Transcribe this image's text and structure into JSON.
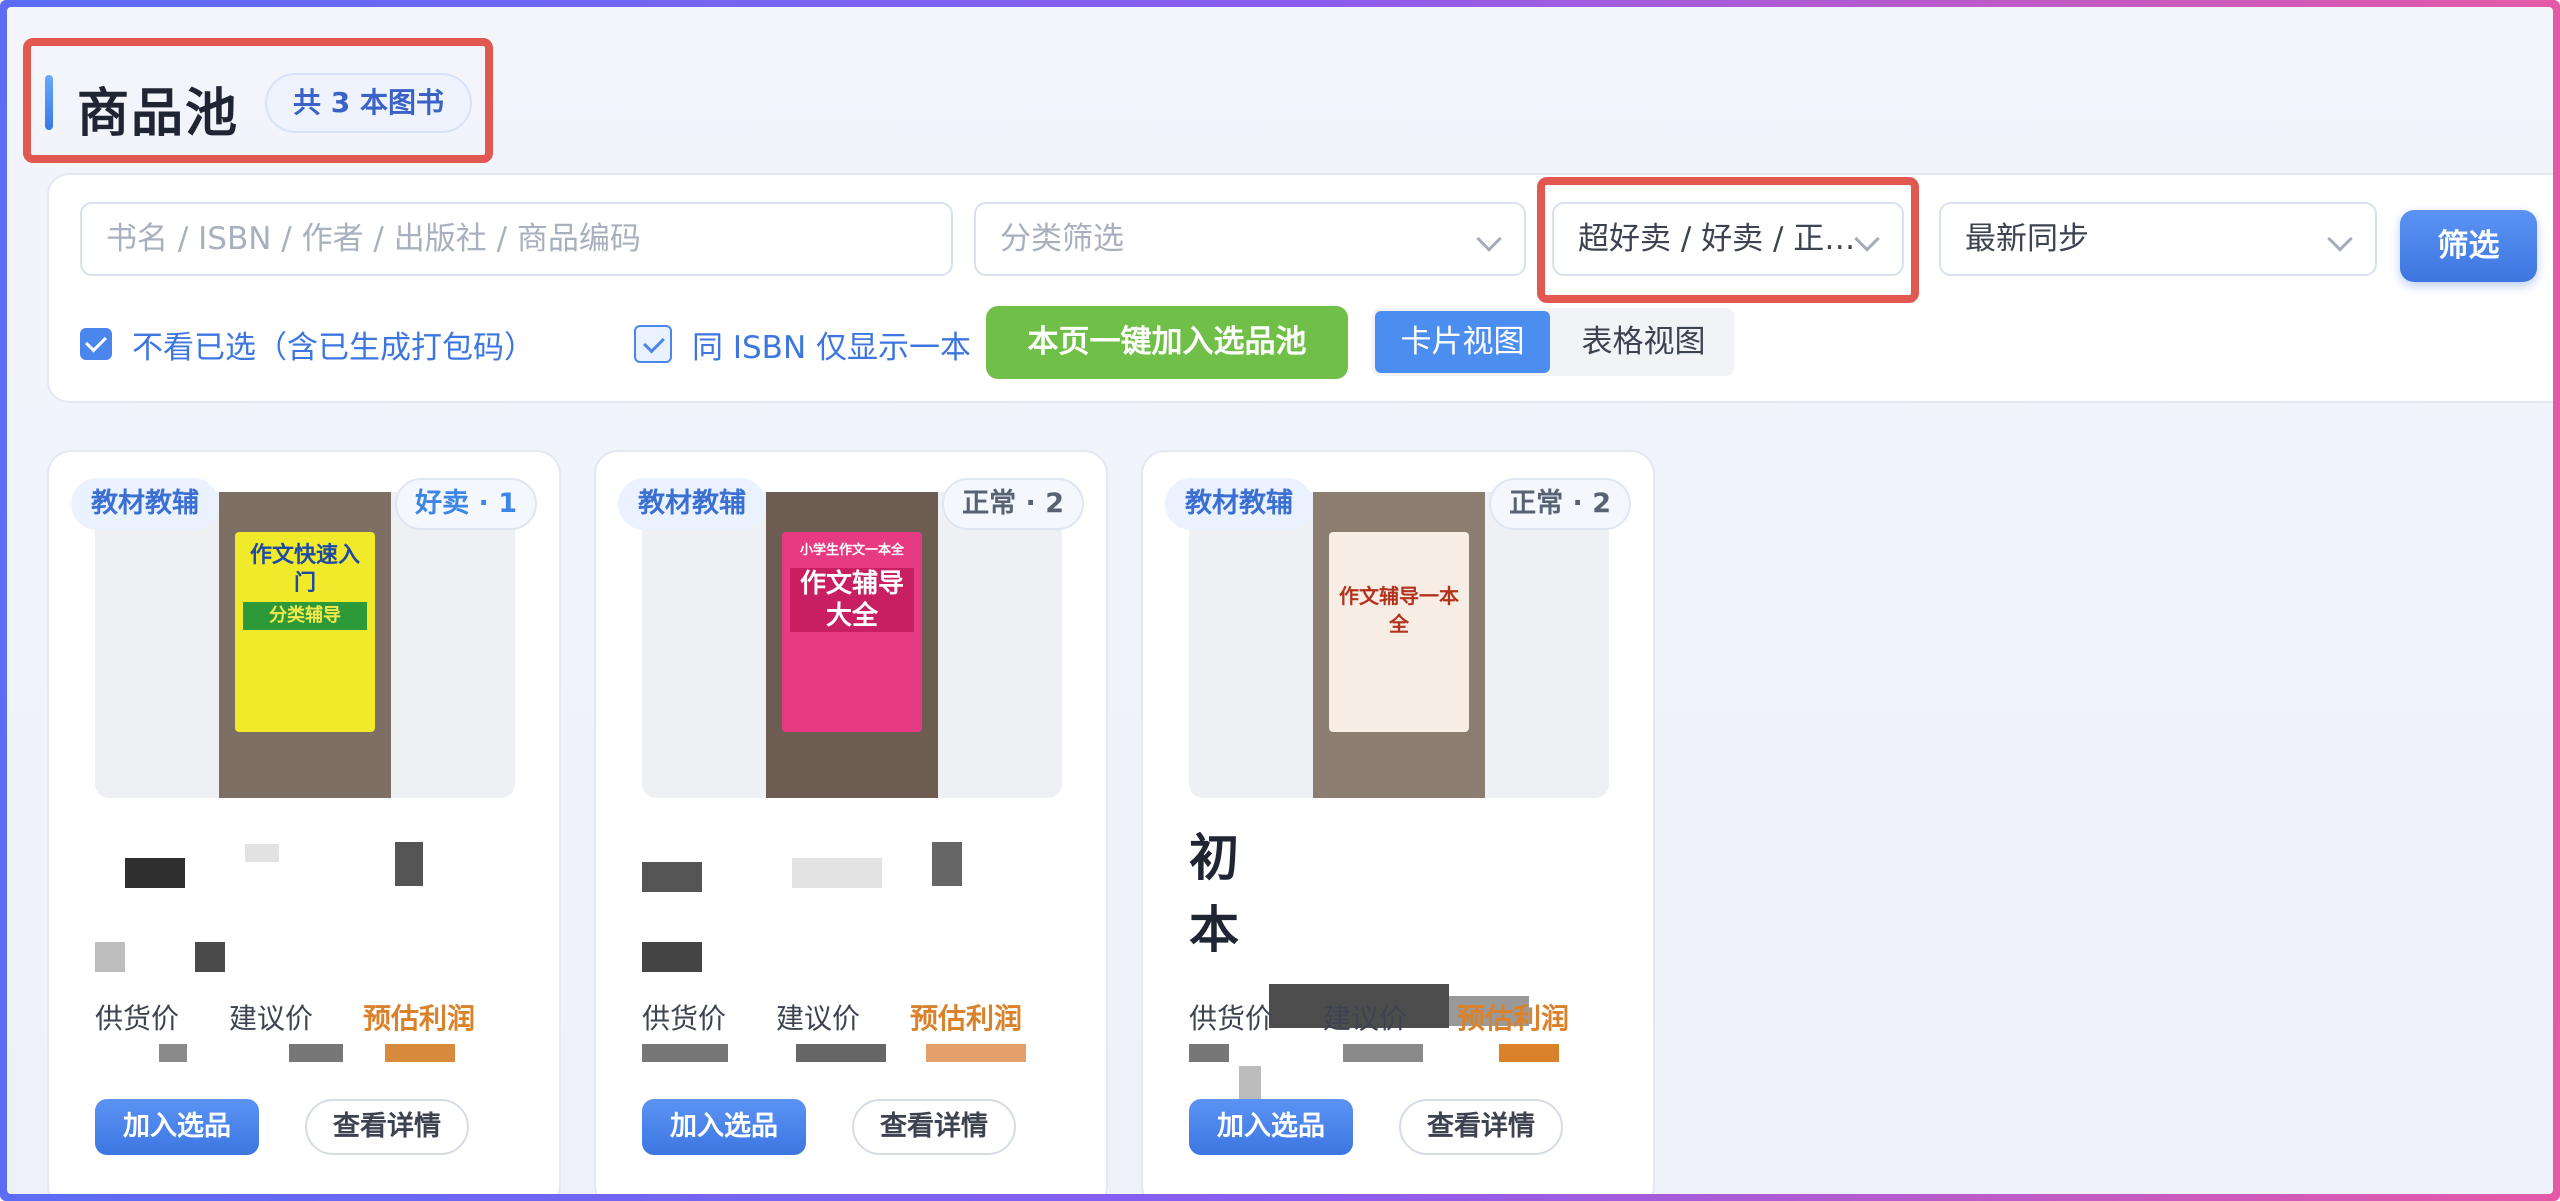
{
  "header": {
    "title": "商品池",
    "count_badge": "共 3 本图书"
  },
  "filters": {
    "search_placeholder": "书名 / ISBN / 作者 / 出版社 / 商品编码",
    "category_placeholder": "分类筛选",
    "sales_level_value": "超好卖 / 好卖 / 正…",
    "sort_value": "最新同步",
    "filter_button": "筛选",
    "hide_selected_label": "不看已选（含已生成打包码）",
    "same_isbn_label": "同 ISBN 仅显示一本",
    "add_page_button": "本页一键加入选品池",
    "view_card": "卡片视图",
    "view_table": "表格视图"
  },
  "cards": [
    {
      "category": "教材教辅",
      "status": "好卖 · 1",
      "cover_title": "作文快速入门",
      "cover_sub": "分类辅导",
      "name_visible": "",
      "supply_label": "供货价",
      "suggest_label": "建议价",
      "profit_label": "预估利润",
      "add_button": "加入选品",
      "detail_button": "查看详情"
    },
    {
      "category": "教材教辅",
      "status": "正常 · 2",
      "cover_title": "作文辅导大全",
      "cover_sub": "小学生作文一本全",
      "name_visible": "",
      "supply_label": "供货价",
      "suggest_label": "建议价",
      "profit_label": "预估利润",
      "add_button": "加入选品",
      "detail_button": "查看详情"
    },
    {
      "category": "教材教辅",
      "status": "正常 · 2",
      "cover_title": "作文辅导一本全",
      "cover_sub": "",
      "name_visible": "初",
      "name_visible_2": "本",
      "supply_label": "供货价",
      "suggest_label": "建议价",
      "profit_label": "预估利润",
      "add_button": "加入选品",
      "detail_button": "查看详情"
    }
  ],
  "colors": {
    "accent_blue": "#3d76e0",
    "green": "#70bf49",
    "highlight_red": "#e0584f",
    "profit_orange": "#d9822b"
  }
}
